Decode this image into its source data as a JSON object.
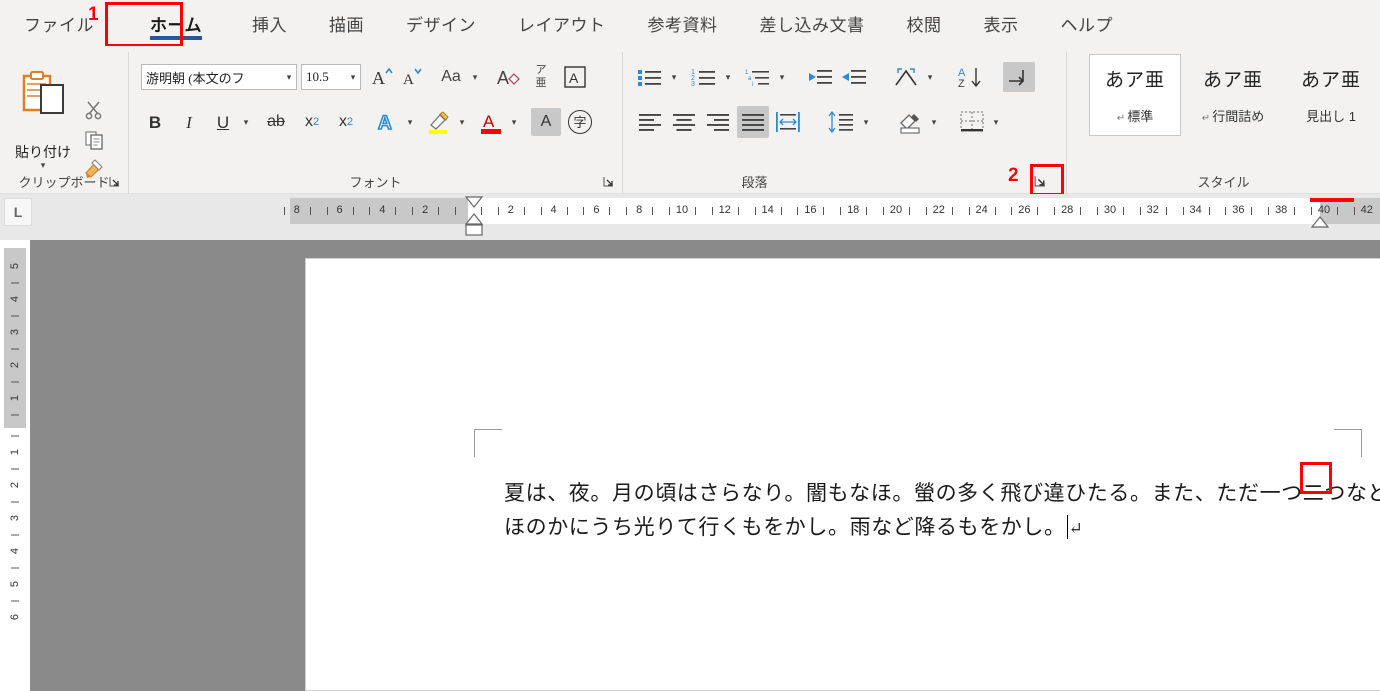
{
  "app": {
    "name": "Microsoft Word"
  },
  "tabs": [
    {
      "label": "ファイル",
      "name": "tab-file",
      "active": false
    },
    {
      "label": "ホーム",
      "name": "tab-home",
      "active": true
    },
    {
      "label": "挿入",
      "name": "tab-insert",
      "active": false
    },
    {
      "label": "描画",
      "name": "tab-draw",
      "active": false
    },
    {
      "label": "デザイン",
      "name": "tab-design",
      "active": false
    },
    {
      "label": "レイアウト",
      "name": "tab-layout",
      "active": false
    },
    {
      "label": "参考資料",
      "name": "tab-references",
      "active": false
    },
    {
      "label": "差し込み文書",
      "name": "tab-mailings",
      "active": false
    },
    {
      "label": "校閲",
      "name": "tab-review",
      "active": false
    },
    {
      "label": "表示",
      "name": "tab-view",
      "active": false
    },
    {
      "label": "ヘルプ",
      "name": "tab-help",
      "active": false
    }
  ],
  "callouts": [
    {
      "number": "1",
      "target": "ホーム tab"
    },
    {
      "number": "2",
      "target": "段落 dialog launcher"
    },
    {
      "number": "",
      "target": "comma in document text"
    }
  ],
  "ribbon": {
    "clipboard": {
      "group_label": "クリップボード",
      "paste_label": "貼り付け",
      "paste_icon": "clipboard-icon",
      "cut_icon": "scissors-icon",
      "copy_icon": "copy-icon",
      "format_painter_icon": "paintbrush-icon",
      "dialog_launcher_icon": "dialog-launcher-icon"
    },
    "font": {
      "group_label": "フォント",
      "font_name_value": "游明朝 (本文のフ",
      "font_size_value": "10.5",
      "grow_font_icon": "grow-font-icon",
      "shrink_font_icon": "shrink-font-icon",
      "change_case_label": "Aa",
      "clear_formatting_icon": "clear-formatting-icon",
      "phonetic_guide_label_top": "ア",
      "phonetic_guide_label_bottom": "亜",
      "character_border_label": "A",
      "bold_label": "B",
      "italic_label": "I",
      "underline_label": "U",
      "strikethrough_label": "ab",
      "subscript_label": "x",
      "subscript_sub": "2",
      "superscript_label": "x",
      "superscript_sup": "2",
      "text_effects_label": "A",
      "highlight_label": "highlight-icon",
      "font_color_label": "A",
      "character_shading_label": "A",
      "enclose_characters_label": "字",
      "dialog_launcher_icon": "dialog-launcher-icon"
    },
    "paragraph": {
      "group_label": "段落",
      "bullets_icon": "bullet-list-icon",
      "numbering_icon": "numbered-list-icon",
      "multilevel_icon": "multilevel-list-icon",
      "decrease_indent_icon": "decrease-indent-icon",
      "increase_indent_icon": "increase-indent-icon",
      "asian_layout_icon": "asian-layout-icon",
      "sort_icon": "sort-az-icon",
      "show_marks_icon": "show-formatting-marks-icon",
      "align_left_icon": "align-left-icon",
      "align_center_icon": "align-center-icon",
      "align_right_icon": "align-right-icon",
      "justify_icon": "justify-icon",
      "distribute_icon": "distribute-icon",
      "line_spacing_icon": "line-spacing-icon",
      "shading_icon": "shading-icon",
      "borders_icon": "borders-icon",
      "dialog_launcher_icon": "dialog-launcher-icon",
      "active_buttons": [
        "justify-icon",
        "show-formatting-marks-icon"
      ]
    },
    "styles": {
      "group_label": "スタイル",
      "items": [
        {
          "sample": "あア亜",
          "mark": "↵",
          "name": "標準",
          "selected": true
        },
        {
          "sample": "あア亜",
          "mark": "↵",
          "name": "行間詰め",
          "selected": false
        },
        {
          "sample": "あア亜",
          "mark": "",
          "name": "見出し 1",
          "selected": false
        }
      ]
    }
  },
  "ruler": {
    "tab_selector_icon": "left-tab-stop-icon",
    "horizontal_numbers": [
      "8",
      "6",
      "4",
      "2",
      "",
      "2",
      "4",
      "6",
      "8",
      "10",
      "12",
      "14",
      "16",
      "18",
      "20",
      "22",
      "24",
      "26",
      "28",
      "30",
      "32",
      "34",
      "36",
      "38",
      "40",
      "42"
    ],
    "vertical_numbers_margin": [
      "5",
      "4",
      "3",
      "2",
      "1"
    ],
    "vertical_numbers_body": [
      "1",
      "2",
      "3",
      "4",
      "5",
      "6"
    ],
    "unit": "字"
  },
  "document": {
    "line1": "夏は、夜。月の頃はさらなり。闇もなほ。螢の多く飛び違ひたる。また、ただ一つ二つなど、",
    "line2": "ほのかにうち光りて行くもをかし。雨など降るもをかし。",
    "paragraph_mark": "↵",
    "highlighted_char": "、"
  },
  "colors": {
    "accent": "#2b579a",
    "callout": "#ff0000",
    "ribbon_bg": "#f3f2f1",
    "page_bg": "#ffffff",
    "canvas_bg": "#8a8a8a",
    "highlight_yellow": "#ffff00",
    "font_color_red": "#ff0000",
    "heading_blue": "#2e74b5"
  }
}
